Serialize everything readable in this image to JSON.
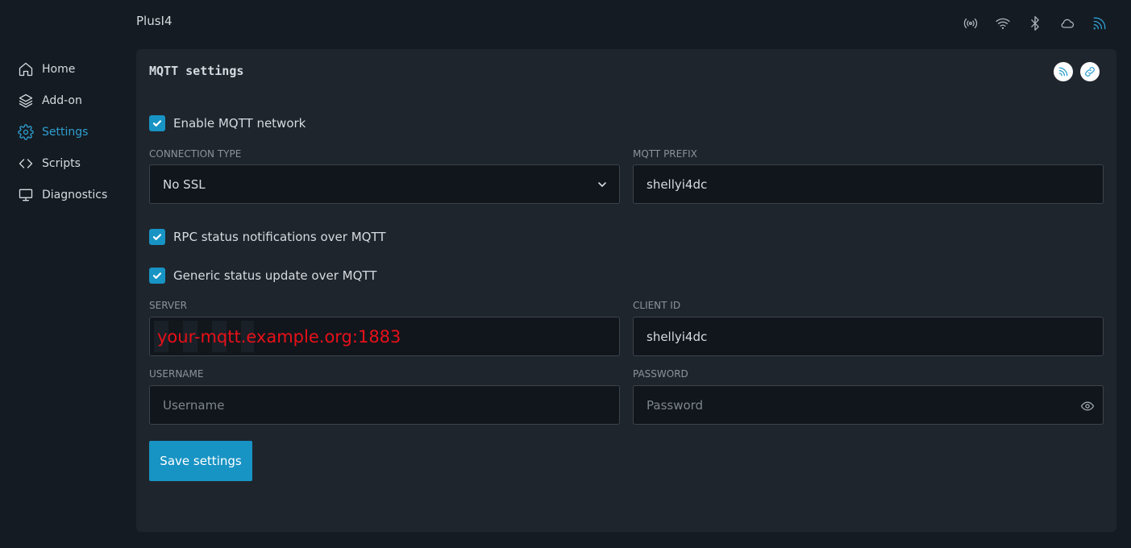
{
  "header": {
    "device_name": "PlusI4",
    "status_icons": [
      "antenna-icon",
      "wifi-icon",
      "bluetooth-icon",
      "cloud-icon",
      "mqtt-icon"
    ]
  },
  "sidebar": {
    "items": [
      {
        "label": "Home",
        "icon": "home-icon"
      },
      {
        "label": "Add-on",
        "icon": "layers-icon"
      },
      {
        "label": "Settings",
        "icon": "gear-icon",
        "active": true
      },
      {
        "label": "Scripts",
        "icon": "code-icon"
      },
      {
        "label": "Diagnostics",
        "icon": "monitor-icon"
      }
    ]
  },
  "panel": {
    "title": "MQTT settings",
    "enable_label": "Enable MQTT network",
    "enable_checked": true,
    "connection_type_label": "CONNECTION TYPE",
    "connection_type_value": "No SSL",
    "prefix_label": "MQTT PREFIX",
    "prefix_value": "shellyi4dc",
    "rpc_label": "RPC status notifications over MQTT",
    "rpc_checked": true,
    "generic_label": "Generic status update over MQTT",
    "generic_checked": true,
    "server_label": "SERVER",
    "server_value": "your-mqtt.example.org:1883",
    "client_id_label": "CLIENT ID",
    "client_id_value": "shellyi4dc",
    "username_label": "USERNAME",
    "username_placeholder": "Username",
    "password_label": "PASSWORD",
    "password_placeholder": "Password",
    "save_label": "Save settings"
  },
  "colors": {
    "accent": "#1793c4",
    "background": "#141b22",
    "panel": "#1f252d",
    "server_text": "#e8101a"
  }
}
